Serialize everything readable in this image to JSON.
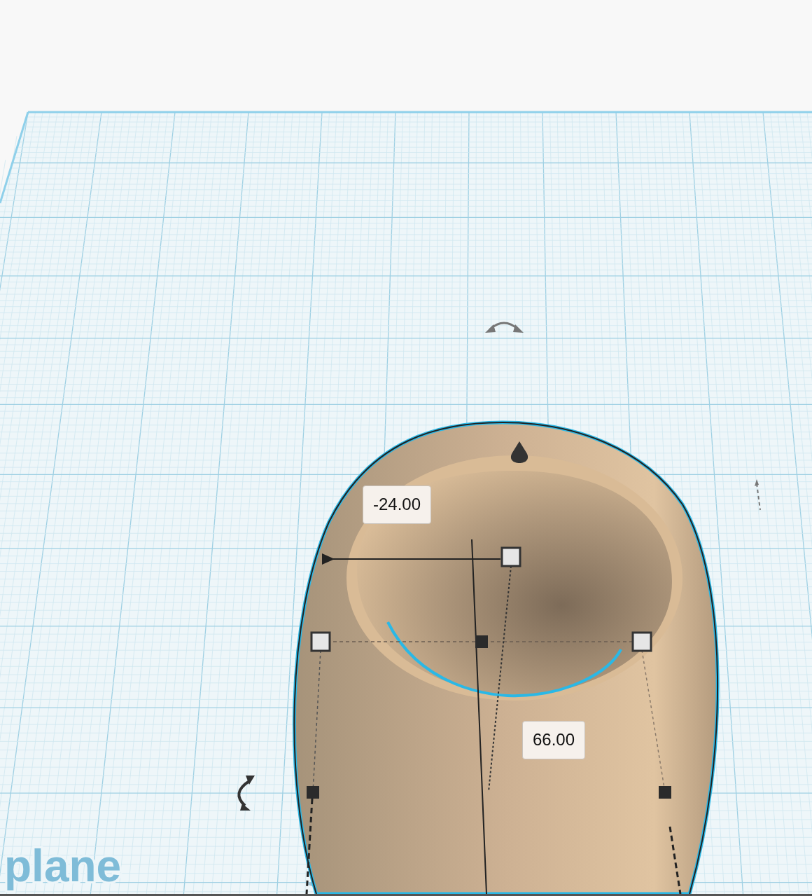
{
  "workplane": {
    "label": "plane"
  },
  "dimension_labels": [
    {
      "text": "-24.00"
    },
    {
      "text": "66.00"
    }
  ]
}
